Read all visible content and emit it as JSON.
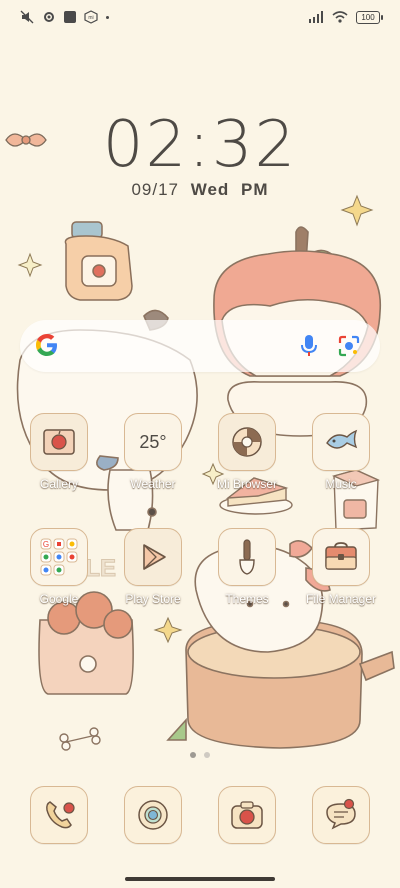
{
  "status_bar": {
    "left_icons": [
      "mute-icon",
      "settings-icon",
      "square-icon",
      "mi-icon",
      "dot-icon"
    ],
    "battery": "100"
  },
  "lock": {
    "time": "02:32",
    "date": "09/17",
    "day": "Wed",
    "ampm": "PM"
  },
  "search": {
    "icons": [
      "google-logo",
      "mic-icon",
      "lens-icon"
    ]
  },
  "apps": [
    {
      "label": "Gallery",
      "icon": "gallery-icon"
    },
    {
      "label": "Weather",
      "icon": "weather-icon",
      "temp": "25°"
    },
    {
      "label": "Mi Browser",
      "icon": "browser-icon"
    },
    {
      "label": "Music",
      "icon": "music-icon"
    },
    {
      "label": "Google",
      "icon": "google-folder-icon"
    },
    {
      "label": "Play Store",
      "icon": "play-store-icon"
    },
    {
      "label": "Themes",
      "icon": "themes-icon"
    },
    {
      "label": "File Manager",
      "icon": "file-manager-icon"
    }
  ],
  "dock": [
    {
      "icon": "phone-icon"
    },
    {
      "icon": "chrome-icon"
    },
    {
      "icon": "camera-icon"
    },
    {
      "icon": "messages-icon"
    }
  ],
  "pages": {
    "current": 1,
    "total": 2
  },
  "colors": {
    "background": "#fbf5e6",
    "tile": "#f7ecd9",
    "tile_border": "#d8b893",
    "accent_red": "#e3685a"
  }
}
